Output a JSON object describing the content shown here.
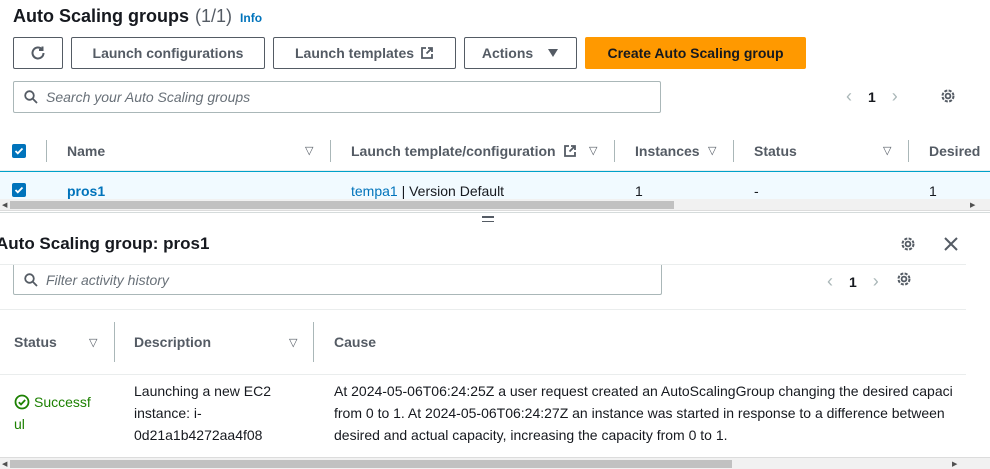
{
  "header": {
    "title": "Auto Scaling groups",
    "count": "(1/1)",
    "info": "Info"
  },
  "toolbar": {
    "refresh_icon": "refresh-icon",
    "launch_configurations": "Launch configurations",
    "launch_templates": "Launch templates",
    "actions": "Actions",
    "create": "Create Auto Scaling group"
  },
  "search": {
    "placeholder": "Search your Auto Scaling groups"
  },
  "pagination": {
    "page": "1"
  },
  "table": {
    "columns": [
      "Name",
      "Launch template/configuration",
      "Instances",
      "Status",
      "Desired"
    ],
    "rows": [
      {
        "name": "pros1",
        "template_link": "tempa1",
        "template_rest": " | Version Default",
        "instances": "1",
        "status": "-",
        "desired": "1"
      }
    ]
  },
  "detail": {
    "title": "Auto Scaling group: pros1",
    "filter_placeholder": "Filter activity history",
    "page": "1",
    "columns": [
      "Status",
      "Description",
      "Cause"
    ],
    "rows": [
      {
        "status_line1": "Successf",
        "status_line2": "ul",
        "desc_line1": "Launching a new EC2",
        "desc_line2": "instance: i-",
        "desc_line3": "0d21a1b4272aa4f08",
        "cause_line1": "At 2024-05-06T06:24:25Z a user request created an AutoScalingGroup changing the desired capaci",
        "cause_line2": "from 0 to 1. At 2024-05-06T06:24:27Z an instance was started in response to a difference between",
        "cause_line3": "desired and actual capacity, increasing the capacity from 0 to 1."
      }
    ]
  },
  "colors": {
    "primary": "#ff9900",
    "link": "#0073bb",
    "success": "#1d8102"
  }
}
